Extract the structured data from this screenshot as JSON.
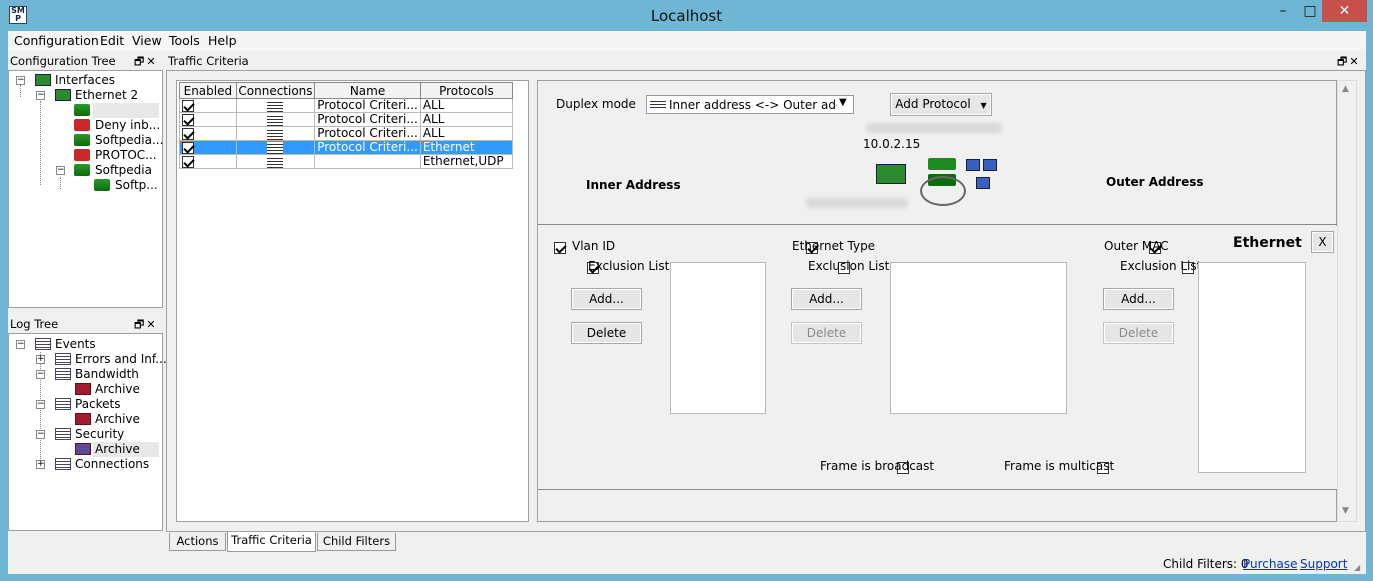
{
  "window": {
    "title": "Localhost",
    "minimize": "–",
    "maximize": "□",
    "close": "✕"
  },
  "menu": [
    "Configuration",
    "Edit",
    "View",
    "Tools",
    "Help"
  ],
  "config_tree": {
    "title": "Configuration Tree",
    "nodes": {
      "interfaces": "Interfaces",
      "ethernet2": "Ethernet 2",
      "deny": "Deny inb...",
      "softpedia1": "Softpedia...",
      "protocol": "PROTOC...",
      "softpedia2": "Softpedia",
      "softp": "Softp..."
    }
  },
  "log_tree": {
    "title": "Log Tree",
    "nodes": {
      "events": "Events",
      "errors": "Errors and Inf...",
      "bandwidth": "Bandwidth",
      "archive1": "Archive",
      "packets": "Packets",
      "archive2": "Archive",
      "security": "Security",
      "archive3": "Archive",
      "connections": "Connections"
    }
  },
  "traffic": {
    "title": "Traffic Criteria",
    "columns": [
      "Enabled",
      "Connections",
      "Name",
      "Protocols"
    ],
    "rows": [
      {
        "name": "Protocol Criteri...",
        "protocols": "ALL"
      },
      {
        "name": "Protocol Criteri...",
        "protocols": "ALL"
      },
      {
        "name": "Protocol Criteri...",
        "protocols": "ALL"
      },
      {
        "name": "Protocol Criteri...",
        "protocols": "Ethernet"
      },
      {
        "name": "",
        "protocols": "Ethernet,UDP"
      }
    ]
  },
  "criteria": {
    "duplex_label": "Duplex mode",
    "duplex_value": "Inner address <-> Outer addres",
    "add_protocol": "Add Protocol",
    "ip": "10.0.2.15",
    "inner": "Inner Address",
    "outer": "Outer Address"
  },
  "ethernet": {
    "title": "Ethernet",
    "close": "X",
    "vlan": {
      "label": "Vlan ID",
      "exclusion": "Exclusion List",
      "add": "Add...",
      "delete": "Delete"
    },
    "ethtype": {
      "label": "Ethernet Type",
      "exclusion": "Exclusion List",
      "add": "Add...",
      "delete": "Delete"
    },
    "outer_mac": {
      "label": "Outer MAC",
      "exclusion": "Exclusion List",
      "add": "Add...",
      "delete": "Delete"
    },
    "broadcast": "Frame is broadcast",
    "multicast": "Frame is multicast"
  },
  "tabs": [
    "Actions",
    "Traffic Criteria",
    "Child Filters"
  ],
  "status": {
    "child_filters": "Child Filters: 0",
    "purchase": "Purchase",
    "support": "Support"
  },
  "colors": {
    "selection": "#3399ff",
    "titlebar": "#6fb5d4",
    "close": "#c7504a"
  }
}
